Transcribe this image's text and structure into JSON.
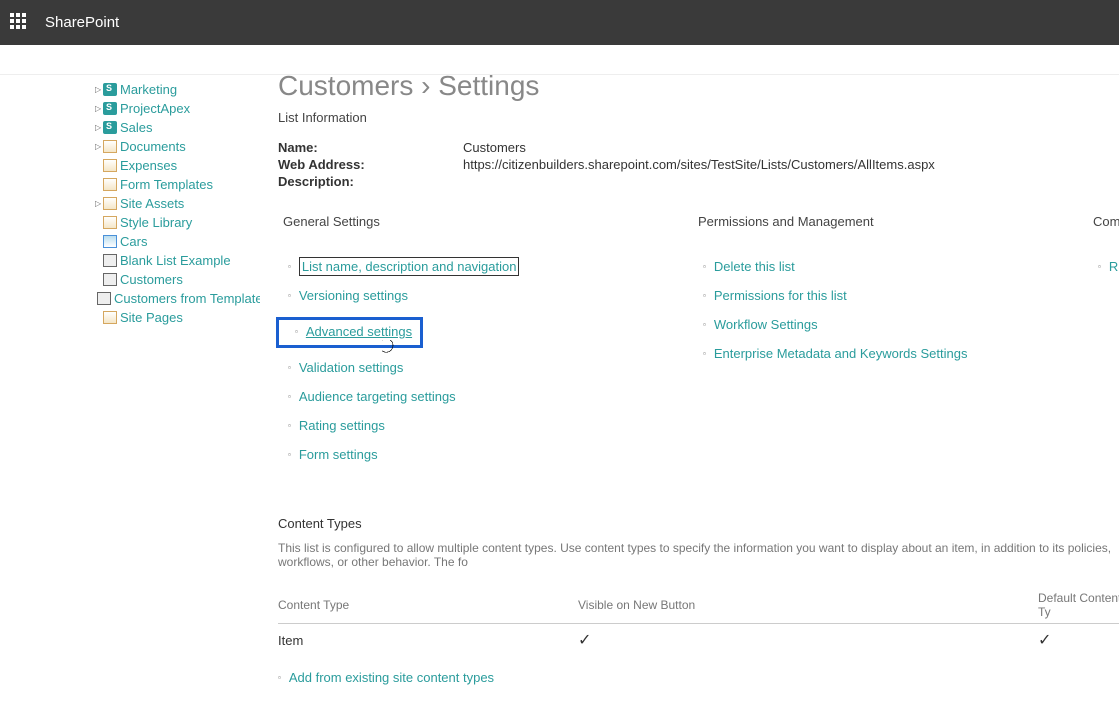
{
  "topbar": {
    "title": "SharePoint"
  },
  "sidebar": {
    "items": [
      {
        "label": "Marketing",
        "icon": "s",
        "expandable": true
      },
      {
        "label": "ProjectApex",
        "icon": "s",
        "expandable": true
      },
      {
        "label": "Sales",
        "icon": "s",
        "expandable": true
      },
      {
        "label": "Documents",
        "icon": "doc",
        "expandable": true
      },
      {
        "label": "Expenses",
        "icon": "doc",
        "expandable": false
      },
      {
        "label": "Form Templates",
        "icon": "doc",
        "expandable": false
      },
      {
        "label": "Site Assets",
        "icon": "doc",
        "expandable": true
      },
      {
        "label": "Style Library",
        "icon": "doc",
        "expandable": false
      },
      {
        "label": "Cars",
        "icon": "img",
        "expandable": false
      },
      {
        "label": "Blank List Example",
        "icon": "lib",
        "expandable": false
      },
      {
        "label": "Customers",
        "icon": "lib",
        "expandable": false
      },
      {
        "label": "Customers from Template",
        "icon": "lib",
        "expandable": false
      },
      {
        "label": "Site Pages",
        "icon": "doc",
        "expandable": false
      }
    ]
  },
  "page": {
    "title": "Customers › Settings",
    "list_info_label": "List Information",
    "name_label": "Name:",
    "name_value": "Customers",
    "web_label": "Web Address:",
    "web_value": "https://citizenbuilders.sharepoint.com/sites/TestSite/Lists/Customers/AllItems.aspx",
    "desc_label": "Description:"
  },
  "columns": {
    "general": {
      "heading": "General Settings",
      "links": [
        "List name, description and navigation",
        "Versioning settings",
        "Advanced settings",
        "Validation settings",
        "Audience targeting settings",
        "Rating settings",
        "Form settings"
      ]
    },
    "permissions": {
      "heading": "Permissions and Management",
      "links": [
        "Delete this list",
        "Permissions for this list",
        "Workflow Settings",
        "Enterprise Metadata and Keywords Settings"
      ]
    },
    "comms": {
      "heading": "Comm",
      "links": [
        "RSS"
      ]
    }
  },
  "content_types": {
    "heading": "Content Types",
    "description": "This list is configured to allow multiple content types. Use content types to specify the information you want to display about an item, in addition to its policies, workflows, or other behavior. The fo",
    "col1": "Content Type",
    "col2": "Visible on New Button",
    "col3": "Default Content Ty",
    "rows": [
      {
        "name": "Item",
        "visible": "✓",
        "default": "✓"
      }
    ],
    "add_link": "Add from existing site content types"
  }
}
